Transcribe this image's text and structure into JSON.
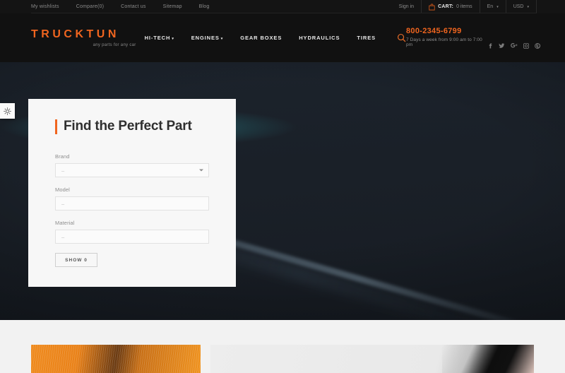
{
  "topbar": {
    "links": [
      {
        "label": "My wishlists"
      },
      {
        "label": "Compare(0)"
      },
      {
        "label": "Contact us"
      },
      {
        "label": "Sitemap"
      },
      {
        "label": "Blog"
      }
    ],
    "sign_in": "Sign in",
    "cart_label": "CART:",
    "cart_count": "0 items",
    "language": "En",
    "currency": "USD"
  },
  "header": {
    "logo": "TRUCKTUN",
    "tagline": "any parts for any car",
    "nav": [
      {
        "label": "HI-TECH",
        "has_dropdown": true
      },
      {
        "label": "ENGINES",
        "has_dropdown": true
      },
      {
        "label": "GEAR BOXES",
        "has_dropdown": false
      },
      {
        "label": "HYDRAULICS",
        "has_dropdown": false
      },
      {
        "label": "TIRES",
        "has_dropdown": false
      }
    ],
    "phone": "800-2345-6799",
    "hours": "7 Days a week from 9:00 am to 7:00 pm",
    "socials": [
      "facebook-icon",
      "twitter-icon",
      "google-plus-icon",
      "instagram-icon",
      "pinterest-icon"
    ],
    "search_icon": "search-icon"
  },
  "panel": {
    "title": "Find the Perfect Part",
    "fields": [
      {
        "label": "Brand",
        "value": "–",
        "has_dropdown": true
      },
      {
        "label": "Model",
        "value": "–",
        "has_dropdown": false
      },
      {
        "label": "Material",
        "value": "–",
        "has_dropdown": false
      }
    ],
    "submit": "SHOW 0"
  },
  "edge_tab": {
    "icon": "settings-tools-icon"
  },
  "colors": {
    "accent": "#f0651f",
    "topbar_bg": "#141414",
    "header_bg": "#111111",
    "hero_bg": "#1a2028",
    "panel_bg": "#f7f7f7",
    "section_bg": "#f2f2f2",
    "hero_glow": "#267880"
  }
}
